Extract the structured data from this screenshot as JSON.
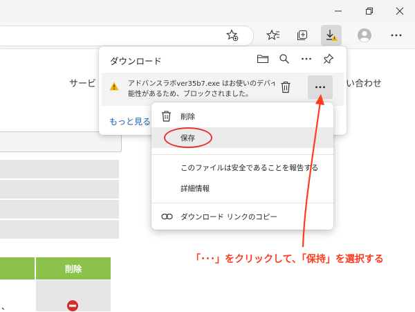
{
  "browser": {
    "window_controls": [
      "minimize-icon",
      "restore-icon",
      "close-icon"
    ],
    "toolbar_icons": [
      "favorite-add-icon",
      "favorites-icon",
      "collections-icon",
      "downloads-warning-icon",
      "profile-icon",
      "more-icon"
    ]
  },
  "page": {
    "nav_left": "サービ",
    "nav_right": "い合わせ",
    "table_headers": [
      "",
      "削除"
    ],
    "table_cell": "、"
  },
  "download_panel": {
    "title": "ダウンロード",
    "header_icons": [
      "folder-icon",
      "search-icon",
      "more-icon",
      "pin-icon"
    ],
    "item": {
      "line1": "アドバンスラボver35b7.exe はお使いのデバイ",
      "line2": "能性があるため、ブロックされました。",
      "more_label": "…"
    },
    "see_more": "もっと見る"
  },
  "context_menu": {
    "items": [
      {
        "label": "削除",
        "icon": "trash-icon"
      },
      {
        "label": "保存",
        "icon": ""
      },
      {
        "label": "このファイルは安全であることを報告する",
        "icon": ""
      },
      {
        "label": "詳細情報",
        "icon": ""
      },
      {
        "label": "ダウンロード リンクのコピー",
        "icon": "link-icon"
      }
    ]
  },
  "annotation": {
    "text": "「･･･」をクリックして、「保持」を選択する",
    "color": "#ff3b1f"
  },
  "colors": {
    "accent_green": "#8bc34a",
    "highlight_red": "#e53232",
    "warning_yellow": "#f0b400",
    "link_blue": "#1a5fb4"
  }
}
